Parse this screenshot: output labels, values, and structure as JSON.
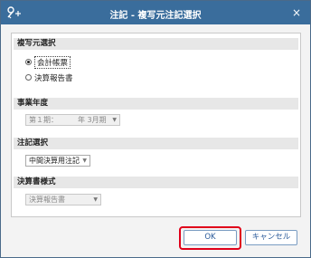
{
  "window": {
    "title": "注記 - 複写元注記選択",
    "close_label": "×"
  },
  "icons": {
    "title_icon": "key-plus-icon",
    "close": "close-icon",
    "dropdown": "chevron-down-icon"
  },
  "sections": {
    "copy_source": {
      "heading": "複写元選択",
      "options": [
        {
          "label": "会計帳票",
          "selected": true
        },
        {
          "label": "決算報告書",
          "selected": false
        }
      ]
    },
    "fiscal_year": {
      "heading": "事業年度",
      "value_prefix": "第１期：",
      "value_suffix": "年 3月期",
      "enabled": false
    },
    "note_select": {
      "heading": "注記選択",
      "value": "中間決算用注記",
      "enabled": true
    },
    "statement_style": {
      "heading": "決算書様式",
      "value": "決算報告書",
      "enabled": false
    }
  },
  "buttons": {
    "ok": "OK",
    "cancel": "キャンセル"
  },
  "colors": {
    "titlebar": "#3a6d9c",
    "highlight": "#e0001a",
    "button_text": "#2a5a9a"
  }
}
